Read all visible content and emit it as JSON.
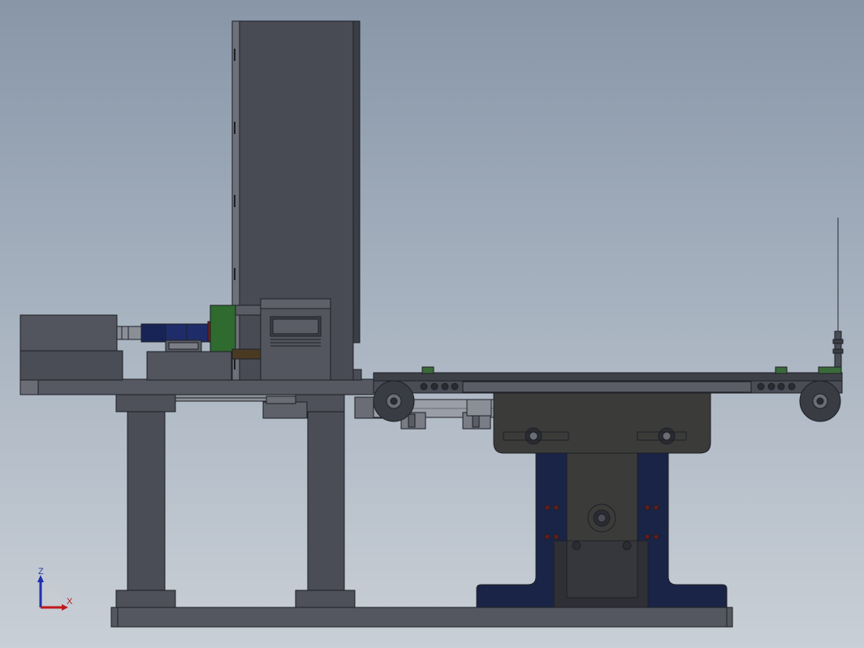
{
  "triad": {
    "z_label": "Z",
    "x_label": "X",
    "z_color": "#1f2fb0",
    "x_color": "#c01818"
  },
  "colors": {
    "background_top": "#8896a8",
    "background_bottom": "#c9cfd6",
    "frame_dark": "#4a4d56",
    "frame_medium": "#5a5d66",
    "edge": "#1e2026",
    "navy_parts": "#1a2446",
    "blue_coupling": "#1e2d6a",
    "green_plate": "#2f6a2f",
    "red_part": "#7a1a1a",
    "brown_part": "#4a3a22"
  }
}
